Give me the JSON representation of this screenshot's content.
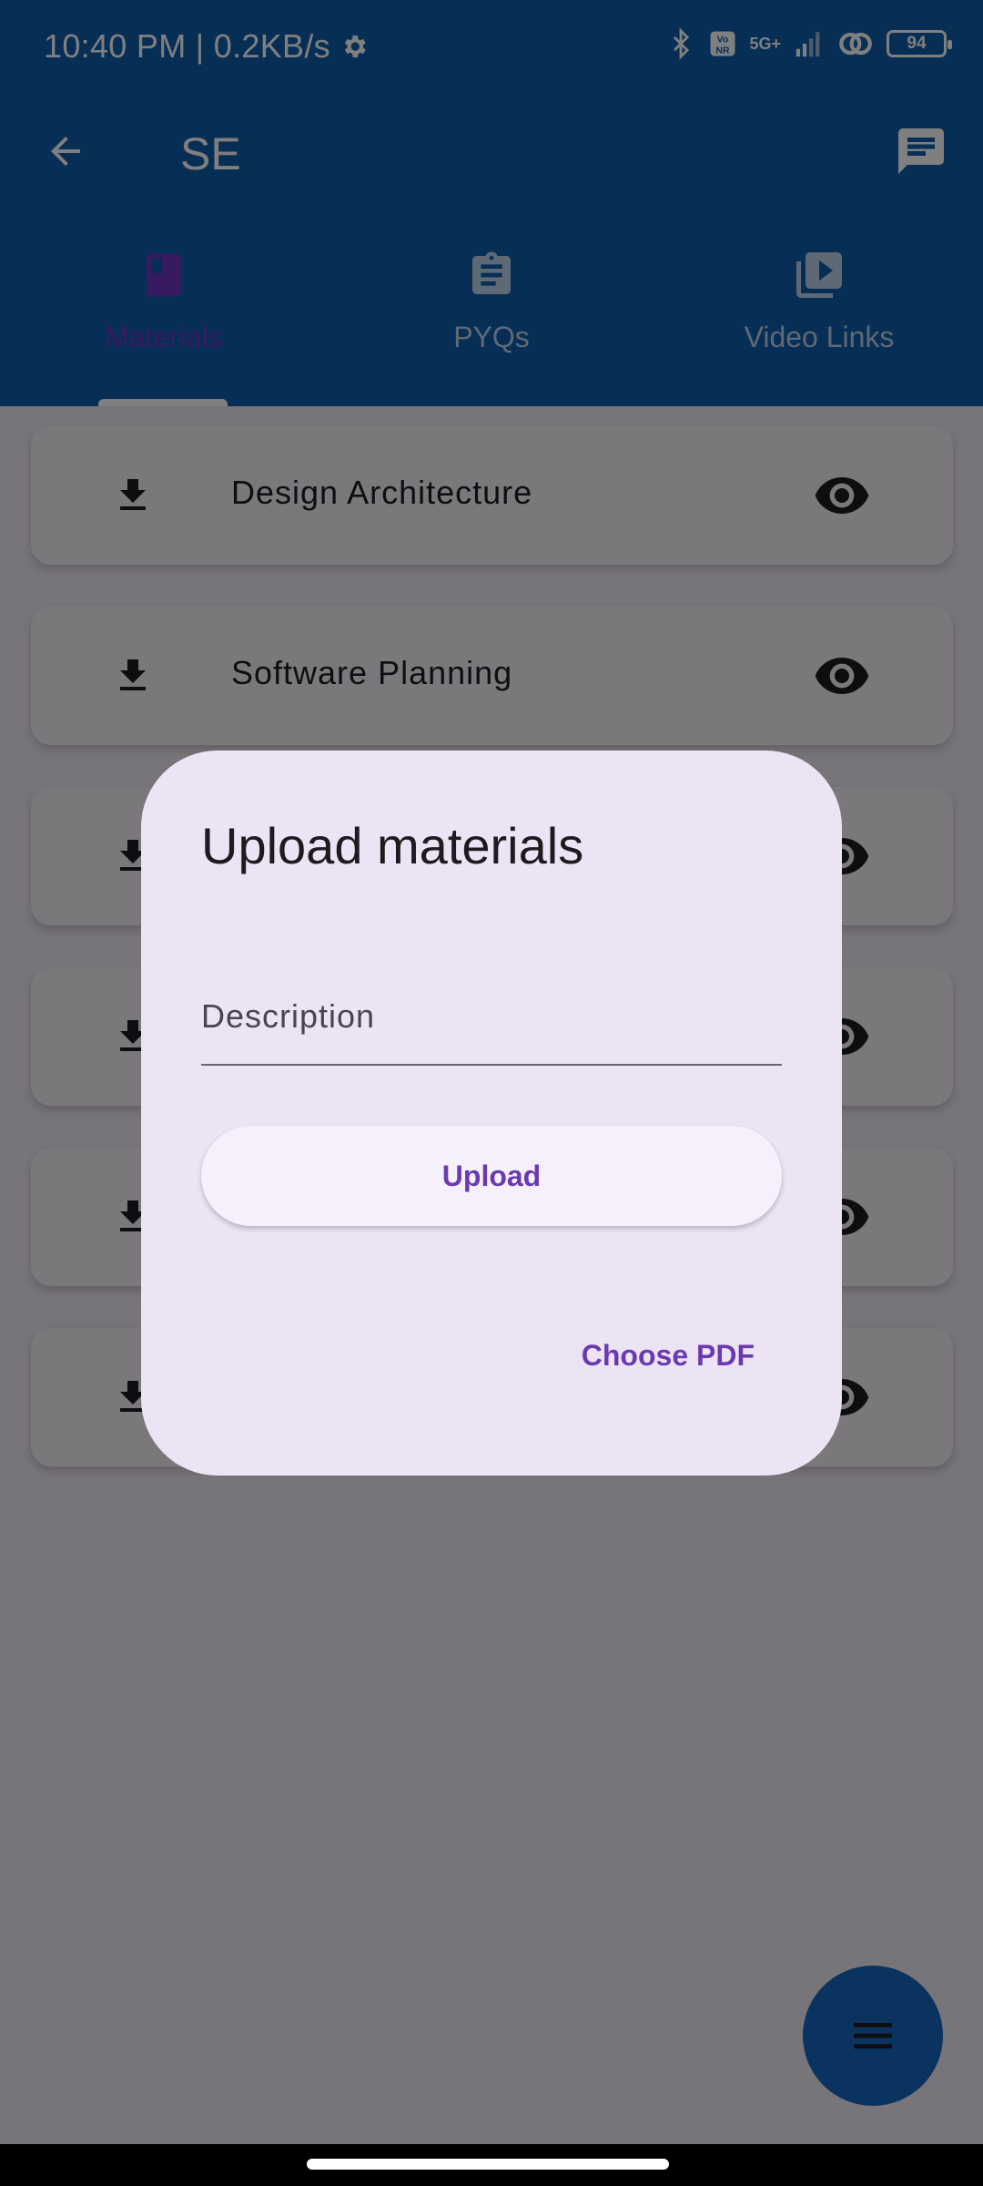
{
  "status_bar": {
    "time": "10:40 PM | 0.2KB/s",
    "network": "5G+",
    "battery": "94"
  },
  "app_bar": {
    "title": "SE"
  },
  "tabs": [
    {
      "label": "Materials",
      "icon": "book-icon",
      "active": true
    },
    {
      "label": "PYQs",
      "icon": "clipboard-icon",
      "active": false
    },
    {
      "label": "Video Links",
      "icon": "video-library-icon",
      "active": false
    }
  ],
  "materials": [
    {
      "title": "Design Architecture"
    },
    {
      "title": "Software Planning"
    },
    {
      "title": ""
    },
    {
      "title": ""
    },
    {
      "title": ""
    },
    {
      "title": ""
    }
  ],
  "dialog": {
    "title": "Upload materials",
    "description_placeholder": "Description",
    "description_value": "",
    "upload_label": "Upload",
    "choose_label": "Choose PDF"
  },
  "colors": {
    "primary": "#0f5cab",
    "accent": "#6a3bb0",
    "dialog_bg": "#ece4f5"
  }
}
